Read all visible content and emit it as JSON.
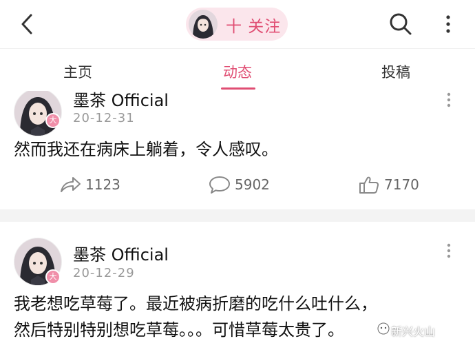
{
  "header": {
    "follow_label": "十 关注"
  },
  "tabs": [
    {
      "label": "主页"
    },
    {
      "label": "动态"
    },
    {
      "label": "投稿"
    }
  ],
  "posts": [
    {
      "author": "墨茶 Official",
      "date": "20-12-31",
      "text": "然而我还在病床上躺着，令人感叹。",
      "shares": "1123",
      "comments": "5902",
      "likes": "7170"
    },
    {
      "author": "墨茶 Official",
      "date": "20-12-29",
      "text_line1": "我老想吃草莓了。最近被病折磨的吃什么吐什么，",
      "text_line2": "然后特别特别想吃草莓。。。可惜草莓太贵了。"
    }
  ],
  "badge_char": "大",
  "watermark": "新兴火山",
  "colors": {
    "accent": "#e04e73",
    "pill_bg": "#fbe6ec",
    "badge": "#f08fa9"
  }
}
